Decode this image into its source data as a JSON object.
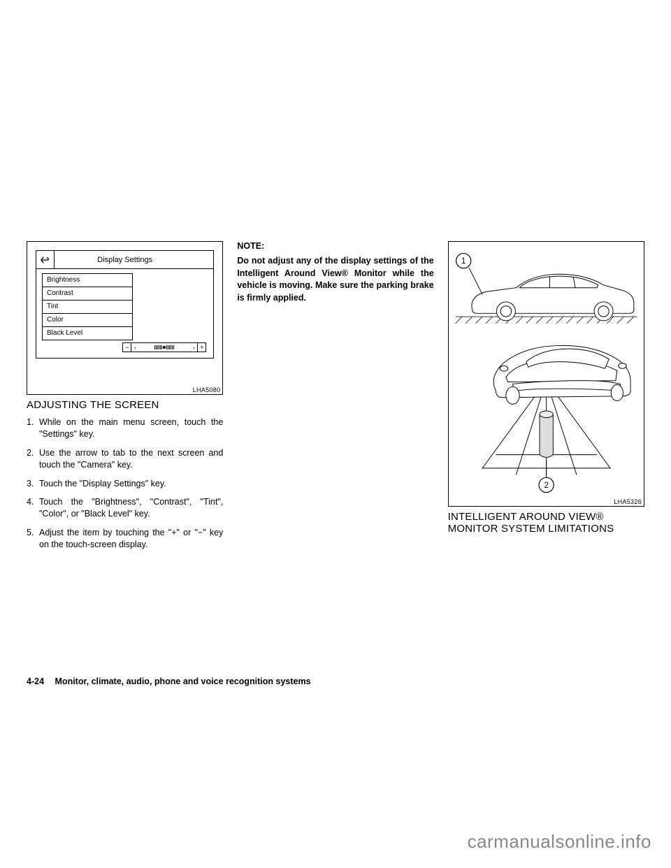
{
  "column_left": {
    "figure_label": "LHA5080",
    "display_settings": {
      "title": "Display Settings",
      "items": [
        "Brightness",
        "Contrast",
        "Tint",
        "Color",
        "Black Level"
      ],
      "minus": "−",
      "plus": "+"
    },
    "heading": "ADJUSTING THE SCREEN",
    "steps": [
      "While on the main menu screen, touch the \"Settings\" key.",
      "Use the arrow to tab to the next screen and touch the \"Camera\" key.",
      "Touch the \"Display Settings\" key.",
      "Touch the \"Brightness\", \"Contrast\", \"Tint\", \"Color\", or \"Black Level\" key.",
      "Adjust the item by touching the \"+\" or \"−\" key on the touch-screen display."
    ]
  },
  "column_middle": {
    "note_label": "NOTE:",
    "note_text": "Do not adjust any of the display settings of the Intelligent Around View® Monitor while the vehicle is moving. Make sure the parking brake is firmly applied."
  },
  "column_right": {
    "figure_label": "LHA5326",
    "callout_1": "1",
    "callout_2": "2",
    "heading": "INTELLIGENT AROUND VIEW® MONITOR SYSTEM LIMITATIONS"
  },
  "footer": {
    "page_num": "4-24",
    "section": "Monitor, climate, audio, phone and voice recognition systems"
  },
  "watermark": "carmanualsonline.info"
}
